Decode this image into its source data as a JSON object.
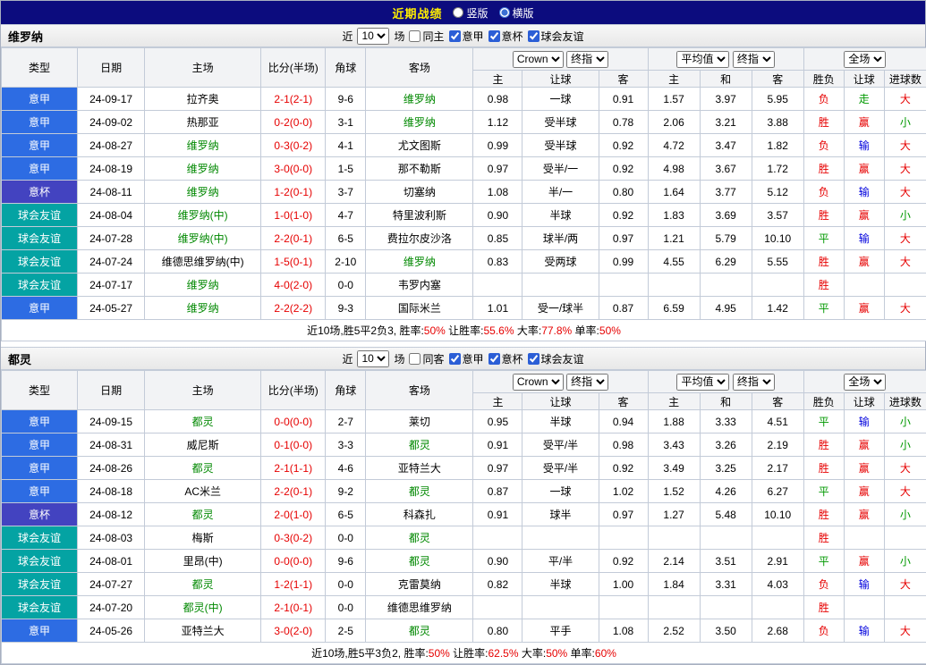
{
  "titlebar": {
    "title": "近期战绩",
    "options": [
      {
        "label": "竖版",
        "selected": false
      },
      {
        "label": "横版",
        "selected": true
      }
    ]
  },
  "table_header": {
    "type": "类型",
    "date": "日期",
    "home": "主场",
    "score": "比分(半场)",
    "corner": "角球",
    "away": "客场",
    "ah_book_select": "Crown",
    "ah_stage_select": "终指",
    "eu_book_select": "平均值",
    "eu_stage_select": "终指",
    "full_select": "全场",
    "sub": [
      "主",
      "让球",
      "客",
      "主",
      "和",
      "客",
      "胜负",
      "让球",
      "进球数"
    ]
  },
  "league_colors": {
    "意甲": "#2d6ce3",
    "意杯": "#4343c0",
    "球会友谊": "#04a3a3"
  },
  "result_colors": {
    "r": "#e60000",
    "g": "#009900",
    "b": "#0000dd"
  },
  "sections": [
    {
      "team": "维罗纳",
      "controls": {
        "near": "近",
        "count": "10",
        "games": "场",
        "same": "同主",
        "same_checked": false,
        "leagues": [
          {
            "label": "意甲",
            "checked": true
          },
          {
            "label": "意杯",
            "checked": true
          },
          {
            "label": "球会友谊",
            "checked": true
          }
        ]
      },
      "rows": [
        {
          "league": "意甲",
          "date": "24-09-17",
          "home": "拉齐奥",
          "hg": false,
          "score": "2-1(2-1)",
          "corner": "9-6",
          "away": "维罗纳",
          "ag": true,
          "ah": [
            "0.98",
            "一球",
            "0.91"
          ],
          "eu": [
            "1.57",
            "3.97",
            "5.95"
          ],
          "res": [
            [
              "负",
              "r"
            ],
            [
              "走",
              "g"
            ],
            [
              "大",
              "r"
            ]
          ]
        },
        {
          "league": "意甲",
          "date": "24-09-02",
          "home": "热那亚",
          "hg": false,
          "score": "0-2(0-0)",
          "corner": "3-1",
          "away": "维罗纳",
          "ag": true,
          "ah": [
            "1.12",
            "受半球",
            "0.78"
          ],
          "eu": [
            "2.06",
            "3.21",
            "3.88"
          ],
          "res": [
            [
              "胜",
              "r"
            ],
            [
              "赢",
              "r"
            ],
            [
              "小",
              "g"
            ]
          ]
        },
        {
          "league": "意甲",
          "date": "24-08-27",
          "home": "维罗纳",
          "hg": true,
          "score": "0-3(0-2)",
          "corner": "4-1",
          "away": "尤文图斯",
          "ag": false,
          "ah": [
            "0.99",
            "受半球",
            "0.92"
          ],
          "eu": [
            "4.72",
            "3.47",
            "1.82"
          ],
          "res": [
            [
              "负",
              "r"
            ],
            [
              "输",
              "b"
            ],
            [
              "大",
              "r"
            ]
          ]
        },
        {
          "league": "意甲",
          "date": "24-08-19",
          "home": "维罗纳",
          "hg": true,
          "score": "3-0(0-0)",
          "corner": "1-5",
          "away": "那不勒斯",
          "ag": false,
          "ah": [
            "0.97",
            "受半/一",
            "0.92"
          ],
          "eu": [
            "4.98",
            "3.67",
            "1.72"
          ],
          "res": [
            [
              "胜",
              "r"
            ],
            [
              "赢",
              "r"
            ],
            [
              "大",
              "r"
            ]
          ]
        },
        {
          "league": "意杯",
          "date": "24-08-11",
          "home": "维罗纳",
          "hg": true,
          "score": "1-2(0-1)",
          "corner": "3-7",
          "away": "切塞纳",
          "ag": false,
          "ah": [
            "1.08",
            "半/一",
            "0.80"
          ],
          "eu": [
            "1.64",
            "3.77",
            "5.12"
          ],
          "res": [
            [
              "负",
              "r"
            ],
            [
              "输",
              "b"
            ],
            [
              "大",
              "r"
            ]
          ]
        },
        {
          "league": "球会友谊",
          "date": "24-08-04",
          "home": "维罗纳(中)",
          "hg": true,
          "score": "1-0(1-0)",
          "corner": "4-7",
          "away": "特里波利斯",
          "ag": false,
          "ah": [
            "0.90",
            "半球",
            "0.92"
          ],
          "eu": [
            "1.83",
            "3.69",
            "3.57"
          ],
          "res": [
            [
              "胜",
              "r"
            ],
            [
              "赢",
              "r"
            ],
            [
              "小",
              "g"
            ]
          ]
        },
        {
          "league": "球会友谊",
          "date": "24-07-28",
          "home": "维罗纳(中)",
          "hg": true,
          "score": "2-2(0-1)",
          "corner": "6-5",
          "away": "费拉尔皮沙洛",
          "ag": false,
          "ah": [
            "0.85",
            "球半/两",
            "0.97"
          ],
          "eu": [
            "1.21",
            "5.79",
            "10.10"
          ],
          "res": [
            [
              "平",
              "g"
            ],
            [
              "输",
              "b"
            ],
            [
              "大",
              "r"
            ]
          ]
        },
        {
          "league": "球会友谊",
          "date": "24-07-24",
          "home": "维德思维罗纳(中)",
          "hg": false,
          "score": "1-5(0-1)",
          "corner": "2-10",
          "away": "维罗纳",
          "ag": true,
          "ah": [
            "0.83",
            "受两球",
            "0.99"
          ],
          "eu": [
            "4.55",
            "6.29",
            "5.55"
          ],
          "res": [
            [
              "胜",
              "r"
            ],
            [
              "赢",
              "r"
            ],
            [
              "大",
              "r"
            ]
          ]
        },
        {
          "league": "球会友谊",
          "date": "24-07-17",
          "home": "维罗纳",
          "hg": true,
          "score": "4-0(2-0)",
          "corner": "0-0",
          "away": "韦罗内塞",
          "ag": false,
          "ah": [
            "",
            "",
            ""
          ],
          "eu": [
            "",
            "",
            ""
          ],
          "res": [
            [
              "胜",
              "r"
            ],
            [
              "",
              ""
            ],
            [
              "",
              ""
            ]
          ]
        },
        {
          "league": "意甲",
          "date": "24-05-27",
          "home": "维罗纳",
          "hg": true,
          "score": "2-2(2-2)",
          "corner": "9-3",
          "away": "国际米兰",
          "ag": false,
          "ah": [
            "1.01",
            "受一/球半",
            "0.87"
          ],
          "eu": [
            "6.59",
            "4.95",
            "1.42"
          ],
          "res": [
            [
              "平",
              "g"
            ],
            [
              "赢",
              "r"
            ],
            [
              "大",
              "r"
            ]
          ]
        }
      ],
      "summary": {
        "prefix": "近10场,胜5平2负3,",
        "stats": [
          [
            "胜率:",
            "50%"
          ],
          [
            "让胜率:",
            "55.6%"
          ],
          [
            "大率:",
            "77.8%"
          ],
          [
            "单率:",
            "50%"
          ]
        ]
      }
    },
    {
      "team": "都灵",
      "controls": {
        "near": "近",
        "count": "10",
        "games": "场",
        "same": "同客",
        "same_checked": false,
        "leagues": [
          {
            "label": "意甲",
            "checked": true
          },
          {
            "label": "意杯",
            "checked": true
          },
          {
            "label": "球会友谊",
            "checked": true
          }
        ]
      },
      "rows": [
        {
          "league": "意甲",
          "date": "24-09-15",
          "home": "都灵",
          "hg": true,
          "score": "0-0(0-0)",
          "corner": "2-7",
          "away": "莱切",
          "ag": false,
          "ah": [
            "0.95",
            "半球",
            "0.94"
          ],
          "eu": [
            "1.88",
            "3.33",
            "4.51"
          ],
          "res": [
            [
              "平",
              "g"
            ],
            [
              "输",
              "b"
            ],
            [
              "小",
              "g"
            ]
          ]
        },
        {
          "league": "意甲",
          "date": "24-08-31",
          "home": "威尼斯",
          "hg": false,
          "score": "0-1(0-0)",
          "corner": "3-3",
          "away": "都灵",
          "ag": true,
          "ah": [
            "0.91",
            "受平/半",
            "0.98"
          ],
          "eu": [
            "3.43",
            "3.26",
            "2.19"
          ],
          "res": [
            [
              "胜",
              "r"
            ],
            [
              "赢",
              "r"
            ],
            [
              "小",
              "g"
            ]
          ]
        },
        {
          "league": "意甲",
          "date": "24-08-26",
          "home": "都灵",
          "hg": true,
          "score": "2-1(1-1)",
          "corner": "4-6",
          "away": "亚特兰大",
          "ag": false,
          "ah": [
            "0.97",
            "受平/半",
            "0.92"
          ],
          "eu": [
            "3.49",
            "3.25",
            "2.17"
          ],
          "res": [
            [
              "胜",
              "r"
            ],
            [
              "赢",
              "r"
            ],
            [
              "大",
              "r"
            ]
          ]
        },
        {
          "league": "意甲",
          "date": "24-08-18",
          "home": "AC米兰",
          "hg": false,
          "score": "2-2(0-1)",
          "corner": "9-2",
          "away": "都灵",
          "ag": true,
          "ah": [
            "0.87",
            "一球",
            "1.02"
          ],
          "eu": [
            "1.52",
            "4.26",
            "6.27"
          ],
          "res": [
            [
              "平",
              "g"
            ],
            [
              "赢",
              "r"
            ],
            [
              "大",
              "r"
            ]
          ]
        },
        {
          "league": "意杯",
          "date": "24-08-12",
          "home": "都灵",
          "hg": true,
          "score": "2-0(1-0)",
          "corner": "6-5",
          "away": "科森扎",
          "ag": false,
          "ah": [
            "0.91",
            "球半",
            "0.97"
          ],
          "eu": [
            "1.27",
            "5.48",
            "10.10"
          ],
          "res": [
            [
              "胜",
              "r"
            ],
            [
              "赢",
              "r"
            ],
            [
              "小",
              "g"
            ]
          ]
        },
        {
          "league": "球会友谊",
          "date": "24-08-03",
          "home": "梅斯",
          "hg": false,
          "score": "0-3(0-2)",
          "corner": "0-0",
          "away": "都灵",
          "ag": true,
          "ah": [
            "",
            "",
            ""
          ],
          "eu": [
            "",
            "",
            ""
          ],
          "res": [
            [
              "胜",
              "r"
            ],
            [
              "",
              ""
            ],
            [
              "",
              ""
            ]
          ]
        },
        {
          "league": "球会友谊",
          "date": "24-08-01",
          "home": "里昂(中)",
          "hg": false,
          "score": "0-0(0-0)",
          "corner": "9-6",
          "away": "都灵",
          "ag": true,
          "ah": [
            "0.90",
            "平/半",
            "0.92"
          ],
          "eu": [
            "2.14",
            "3.51",
            "2.91"
          ],
          "res": [
            [
              "平",
              "g"
            ],
            [
              "赢",
              "r"
            ],
            [
              "小",
              "g"
            ]
          ]
        },
        {
          "league": "球会友谊",
          "date": "24-07-27",
          "home": "都灵",
          "hg": true,
          "score": "1-2(1-1)",
          "corner": "0-0",
          "away": "克雷莫纳",
          "ag": false,
          "ah": [
            "0.82",
            "半球",
            "1.00"
          ],
          "eu": [
            "1.84",
            "3.31",
            "4.03"
          ],
          "res": [
            [
              "负",
              "r"
            ],
            [
              "输",
              "b"
            ],
            [
              "大",
              "r"
            ]
          ]
        },
        {
          "league": "球会友谊",
          "date": "24-07-20",
          "home": "都灵(中)",
          "hg": true,
          "score": "2-1(0-1)",
          "corner": "0-0",
          "away": "维德思维罗纳",
          "ag": false,
          "ah": [
            "",
            "",
            ""
          ],
          "eu": [
            "",
            "",
            ""
          ],
          "res": [
            [
              "胜",
              "r"
            ],
            [
              "",
              ""
            ],
            [
              "",
              ""
            ]
          ]
        },
        {
          "league": "意甲",
          "date": "24-05-26",
          "home": "亚特兰大",
          "hg": false,
          "score": "3-0(2-0)",
          "corner": "2-5",
          "away": "都灵",
          "ag": true,
          "ah": [
            "0.80",
            "平手",
            "1.08"
          ],
          "eu": [
            "2.52",
            "3.50",
            "2.68"
          ],
          "res": [
            [
              "负",
              "r"
            ],
            [
              "输",
              "b"
            ],
            [
              "大",
              "r"
            ]
          ]
        }
      ],
      "summary": {
        "prefix": "近10场,胜5平3负2,",
        "stats": [
          [
            "胜率:",
            "50%"
          ],
          [
            "让胜率:",
            "62.5%"
          ],
          [
            "大率:",
            "50%"
          ],
          [
            "单率:",
            "60%"
          ]
        ]
      }
    }
  ]
}
